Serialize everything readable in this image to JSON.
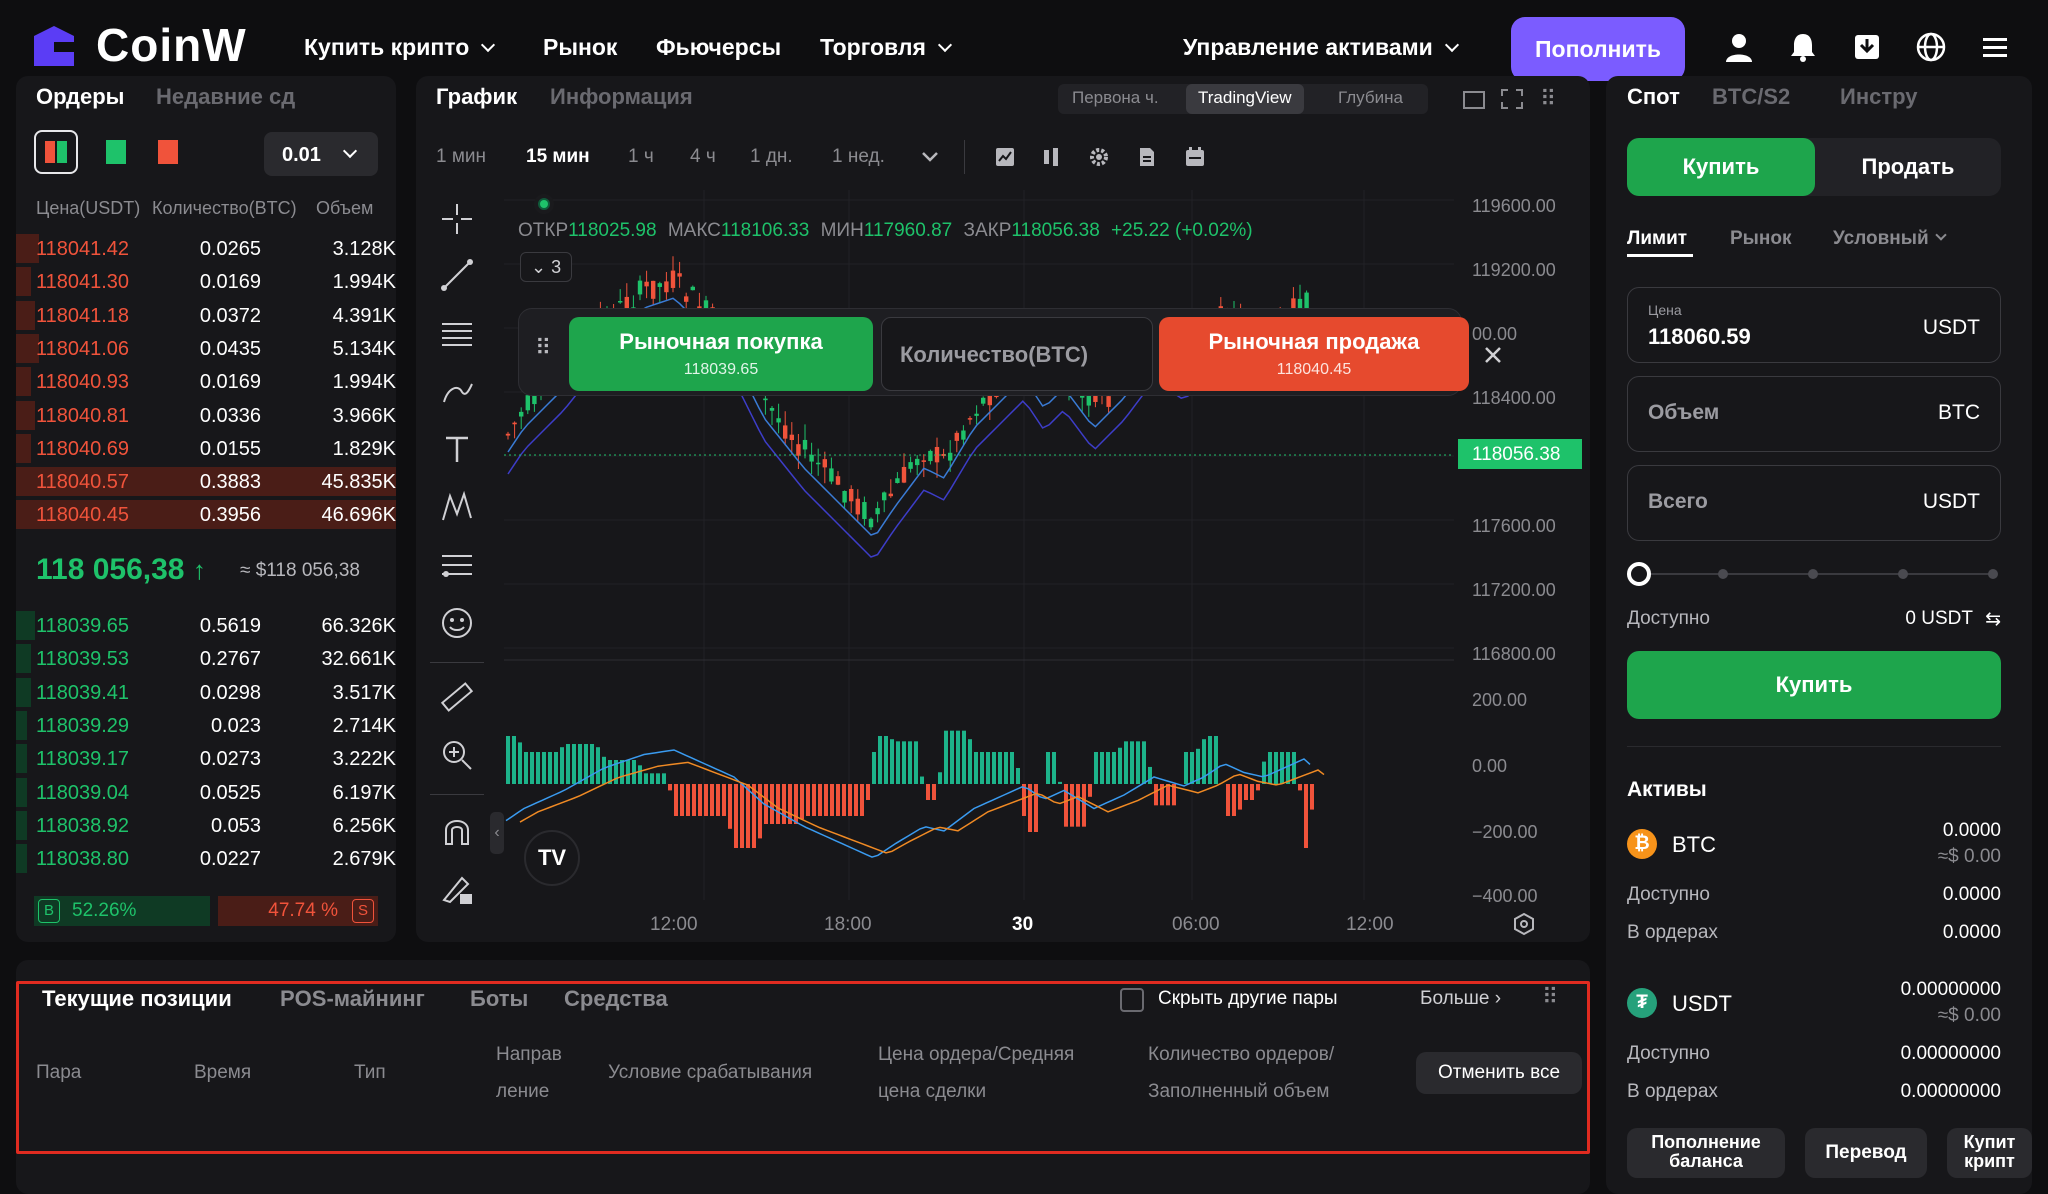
{
  "header": {
    "brand": "CoinW",
    "nav": [
      "Купить крипто",
      "Рынок",
      "Фьючерсы",
      "Торговля",
      "Управление активами"
    ],
    "deposit": "Пополнить",
    "colors": {
      "brand": "#5b3df5",
      "accent": "#7b5cff"
    }
  },
  "orderbook": {
    "tabs": [
      "Ордеры",
      "Недавние сд"
    ],
    "precision": "0.01",
    "headers": {
      "price": "Цена(USDT)",
      "qty": "Количество(BTC)",
      "vol": "Объем"
    },
    "asks": [
      {
        "price": "118041.42",
        "qty": "0.0265",
        "vol": "3.128K",
        "depth": 0.06
      },
      {
        "price": "118041.30",
        "qty": "0.0169",
        "vol": "1.994K",
        "depth": 0.04
      },
      {
        "price": "118041.18",
        "qty": "0.0372",
        "vol": "4.391K",
        "depth": 0.05
      },
      {
        "price": "118041.06",
        "qty": "0.0435",
        "vol": "5.134K",
        "depth": 0.06
      },
      {
        "price": "118040.93",
        "qty": "0.0169",
        "vol": "1.994K",
        "depth": 0.04
      },
      {
        "price": "118040.81",
        "qty": "0.0336",
        "vol": "3.966K",
        "depth": 0.05
      },
      {
        "price": "118040.69",
        "qty": "0.0155",
        "vol": "1.829K",
        "depth": 0.04
      },
      {
        "price": "118040.57",
        "qty": "0.3883",
        "vol": "45.835K",
        "depth": 1.0
      },
      {
        "price": "118040.45",
        "qty": "0.3956",
        "vol": "46.696K",
        "depth": 1.0
      }
    ],
    "last_price": "118 056,38",
    "last_fiat": "≈ $118 056,38",
    "bids": [
      {
        "price": "118039.65",
        "qty": "0.5619",
        "vol": "66.326K",
        "depth": 0.05
      },
      {
        "price": "118039.53",
        "qty": "0.2767",
        "vol": "32.661K",
        "depth": 0.04
      },
      {
        "price": "118039.41",
        "qty": "0.0298",
        "vol": "3.517K",
        "depth": 0.04
      },
      {
        "price": "118039.29",
        "qty": "0.023",
        "vol": "2.714K",
        "depth": 0.03
      },
      {
        "price": "118039.17",
        "qty": "0.0273",
        "vol": "3.222K",
        "depth": 0.03
      },
      {
        "price": "118039.04",
        "qty": "0.0525",
        "vol": "6.197K",
        "depth": 0.03
      },
      {
        "price": "118038.92",
        "qty": "0.053",
        "vol": "6.256K",
        "depth": 0.03
      },
      {
        "price": "118038.80",
        "qty": "0.0227",
        "vol": "2.679K",
        "depth": 0.03
      }
    ],
    "buy_badge": "B",
    "buy_pct": "52.26%",
    "sell_pct": "47.74 %",
    "sell_badge": "S",
    "buy_ratio": 0.5226
  },
  "chart": {
    "tabs": [
      "График",
      "Информация"
    ],
    "view_tabs": [
      "Первона ч.",
      "TradingView",
      "Глубина"
    ],
    "timeframes": [
      "1 мин",
      "15 мин",
      "1 ч",
      "4 ч",
      "1 дн.",
      "1 нед."
    ],
    "active_tf": "15 мин",
    "ohlc": {
      "open_l": "ОТКР",
      "open": "118025.98",
      "high_l": "МАКС",
      "high": "118106.33",
      "low_l": "МИН",
      "low": "117960.87",
      "close_l": "ЗАКР",
      "close": "118056.38",
      "change": "+25.22 (+0.02%)"
    },
    "indicator_count": "3",
    "quick": {
      "buy": "Рыночная покупка",
      "buy_price": "118039.65",
      "qty": "Количество(BTC)",
      "sell": "Рыночная продажа",
      "sell_price": "118040.45"
    },
    "y_labels": [
      "119600.00",
      "119200.00",
      "00.00",
      "118400.00",
      "117600.00",
      "117200.00",
      "116800.00"
    ],
    "current_price": "118056.38",
    "macd_labels": [
      "200.00",
      "0.00",
      "−200.00",
      "−400.00"
    ],
    "x_labels": [
      "12:00",
      "18:00",
      "30",
      "06:00",
      "12:00"
    ],
    "colors": {
      "up": "#1ec26a",
      "down": "#f0533b"
    }
  },
  "trade": {
    "tabs": [
      "Спот",
      "BTC/S2",
      "Инстру"
    ],
    "buy": "Купить",
    "sell": "Продать",
    "order_types": [
      "Лимит",
      "Рынок",
      "Условный"
    ],
    "price_label": "Цена",
    "price_value": "118060.59",
    "price_unit": "USDT",
    "amount_label": "Объем",
    "amount_unit": "BTC",
    "total_label": "Всего",
    "total_unit": "USDT",
    "slider_value": 0,
    "available_label": "Доступно",
    "available_value": "0 USDT",
    "submit": "Купить"
  },
  "assets": {
    "title": "Активы",
    "items": [
      {
        "coin": "BTC",
        "amount": "0.0000",
        "fiat": "≈$ 0.00",
        "available": "0.0000",
        "in_orders": "0.0000"
      },
      {
        "coin": "USDT",
        "amount": "0.00000000",
        "fiat": "≈$ 0.00",
        "available": "0.00000000",
        "in_orders": "0.00000000"
      }
    ],
    "available_label": "Доступно",
    "in_orders_label": "В ордерах",
    "buttons": [
      "Пополнение баланса",
      "Перевод",
      "Купит крипт"
    ]
  },
  "positions": {
    "tabs": [
      "Текущие позиции",
      "POS-майнинг",
      "Боты",
      "Средства"
    ],
    "hide_pairs": "Скрыть другие пары",
    "more": "Больше",
    "columns": [
      "Пара",
      "Время",
      "Тип",
      "Направ ление",
      "Условие срабатывания",
      "Цена ордера/Средняя цена сделки",
      "Количество ордеров/ Заполненный объем"
    ],
    "cancel_all": "Отменить все"
  }
}
